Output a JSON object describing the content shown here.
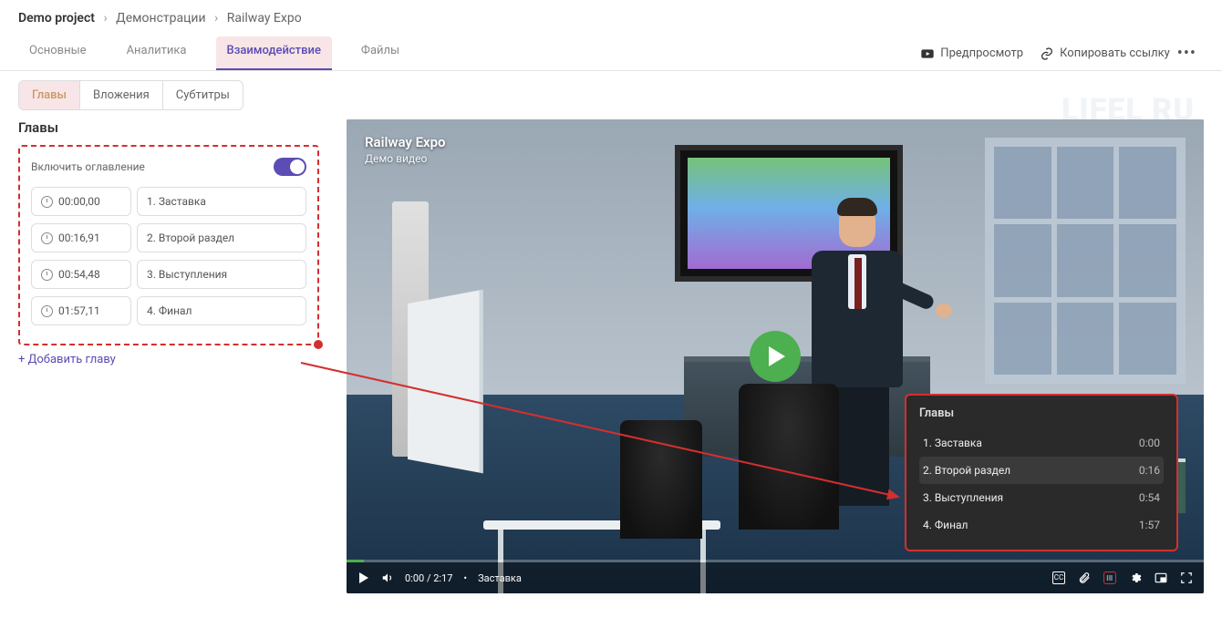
{
  "breadcrumb": {
    "a": "Demo project",
    "b": "Демонстрации",
    "c": "Railway Expo"
  },
  "tabs": {
    "main": "Основные",
    "analytics": "Аналитика",
    "interaction": "Взаимодействие",
    "files": "Файлы"
  },
  "actions": {
    "preview": "Предпросмотр",
    "copy": "Копировать ссылку"
  },
  "subtabs": {
    "chapters": "Главы",
    "attachments": "Вложения",
    "subtitles": "Субтитры"
  },
  "sidebar": {
    "heading": "Главы",
    "toggle_label": "Включить оглавление",
    "chapters": [
      {
        "time": "00:00,00",
        "name": "1. Заставка"
      },
      {
        "time": "00:16,91",
        "name": "2. Второй раздел"
      },
      {
        "time": "00:54,48",
        "name": "3. Выступления"
      },
      {
        "time": "01:57,11",
        "name": "4. Финал"
      }
    ],
    "add": "+ Добавить главу"
  },
  "player": {
    "title": "Railway Expo",
    "subtitle": "Демо видео",
    "time_display": "0:00 / 2:17",
    "current_chapter": "Заставка",
    "watermark": "LIFEL   RU",
    "popup_heading": "Главы",
    "popup": [
      {
        "label": "1. Заставка",
        "t": "0:00"
      },
      {
        "label": "2. Второй раздел",
        "t": "0:16"
      },
      {
        "label": "3. Выступления",
        "t": "0:54"
      },
      {
        "label": "4. Финал",
        "t": "1:57"
      }
    ],
    "cc": "CC"
  }
}
